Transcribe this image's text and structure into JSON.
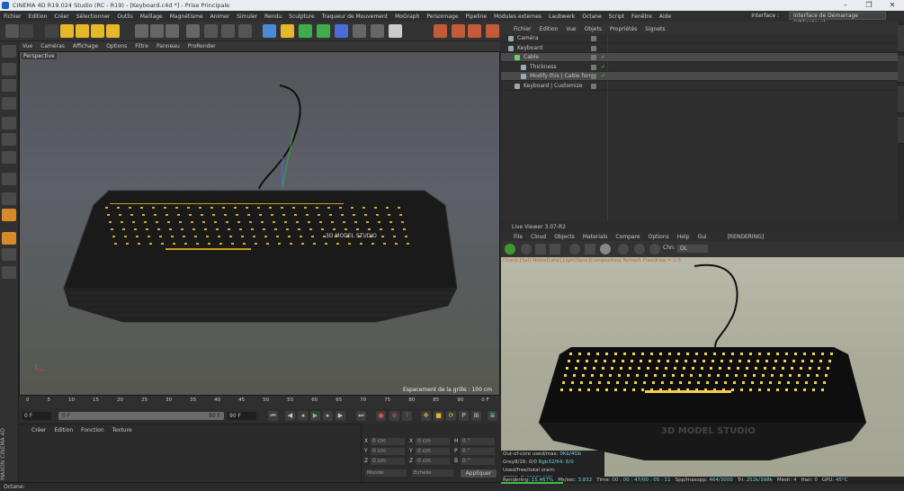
{
  "window": {
    "title": "CINEMA 4D R19.024 Studio (RC - R19) - [Keyboard.c4d *] - Prise Principale",
    "buttons": [
      "–",
      "❐",
      "✕"
    ]
  },
  "menubar": {
    "items": [
      "Fichier",
      "Edition",
      "Créer",
      "Sélectionner",
      "Outils",
      "Maillage",
      "Magnétisme",
      "Animer",
      "Simuler",
      "Rendu",
      "Sculpture",
      "Traqueur de Mouvement",
      "MoGraph",
      "Personnage",
      "Pipeline",
      "Modules externes",
      "Laubwerk",
      "Octane",
      "Script",
      "Fenêtre",
      "Aide"
    ],
    "interface_label": "Interface :",
    "interface_value": "Interface de Démarrage (Utilisateur)"
  },
  "viewport": {
    "menu": [
      "Vue",
      "Caméras",
      "Affichage",
      "Options",
      "Filtre",
      "Panneau",
      "ProRender"
    ],
    "label": "Perspective",
    "grid_text": "Espacement de la grille : 100 cm"
  },
  "timeline": {
    "ticks": [
      "0",
      "5",
      "10",
      "15",
      "20",
      "25",
      "30",
      "35",
      "40",
      "45",
      "50",
      "55",
      "60",
      "65",
      "70",
      "75",
      "80",
      "85",
      "90",
      "0 F"
    ],
    "start_field": "0 F",
    "slider_text": "0 F",
    "slider_end": "90 F",
    "end_field": "90 F"
  },
  "material_manager": {
    "menu": [
      "Créer",
      "Edition",
      "Fonction",
      "Texture"
    ]
  },
  "coords": {
    "rows": [
      [
        "X",
        "0 cm",
        "X",
        "0 cm",
        "H",
        "0 °"
      ],
      [
        "Y",
        "0 cm",
        "Y",
        "0 cm",
        "P",
        "0 °"
      ],
      [
        "Z",
        "0 cm",
        "Z",
        "0 cm",
        "B",
        "0 °"
      ]
    ],
    "mode_a": "Monde",
    "mode_b": "Echelle",
    "apply": "Appliquer"
  },
  "branding": "MAXON CINEMA 4D",
  "statusbar": "Octane:",
  "object_manager": {
    "menu": [
      "Fichier",
      "Edition",
      "Vue",
      "Objets",
      "Propriétés",
      "Signets"
    ],
    "objects": [
      {
        "name": "Caméra",
        "indent": 0,
        "selected": false,
        "checked": false
      },
      {
        "name": "Keyboard",
        "indent": 0,
        "selected": false,
        "checked": false
      },
      {
        "name": "Cable",
        "indent": 1,
        "selected": true,
        "checked": true
      },
      {
        "name": "Thickness",
        "indent": 2,
        "selected": false,
        "checked": true
      },
      {
        "name": "Modify this | Cable form",
        "indent": 2,
        "selected": true,
        "checked": true
      },
      {
        "name": "Keyboard | Customize",
        "indent": 1,
        "selected": false,
        "checked": false
      }
    ]
  },
  "right_tabs": [
    "Objets",
    "Structure",
    "Navigateur de contenu",
    "Couches"
  ],
  "live_viewer": {
    "title": "Live Viewer 3.07-R2",
    "menu": [
      "File",
      "Cloud",
      "Objects",
      "Materials",
      "Compare",
      "Options",
      "Help",
      "Gui"
    ],
    "status": "[RENDERING]",
    "channel_label": "Chn:",
    "channel_value": "DL",
    "error_text": "Check:[Sel]  Noise[Lerp],Light[Spot]Compositing Refresh Freedraw = 0.5",
    "stats": [
      {
        "label": "Out-of-core used/max:",
        "value": "0Kb/4Gb"
      },
      {
        "label": "Grey8/16: 0/0",
        "value": "Rgb32/64: 6/0"
      },
      {
        "label": "Used/free/total vram:",
        "value": "789Mb/2.226Gb/4Gb"
      }
    ],
    "render_status": [
      {
        "label": "Rendering:",
        "value": "15.467%"
      },
      {
        "label": "Ms/sec:",
        "value": "3.832"
      },
      {
        "label": "Time:",
        "value": "00 : 00 : 47/00 : 05 : 11"
      },
      {
        "label": "Spp/maxspp:",
        "value": "464/3000"
      },
      {
        "label": "Tri:",
        "value": "252k/398k"
      },
      {
        "label": "Mesh:",
        "value": "4"
      },
      {
        "label": "Hair:",
        "value": "0"
      },
      {
        "label": "GPU:",
        "value": "45°C"
      }
    ],
    "progress": 0.15467
  },
  "colors": {
    "accent": "#e5b82a",
    "green": "#6fd06f",
    "cyan": "#6cd0e0",
    "key_glow": "#f5d04a"
  }
}
